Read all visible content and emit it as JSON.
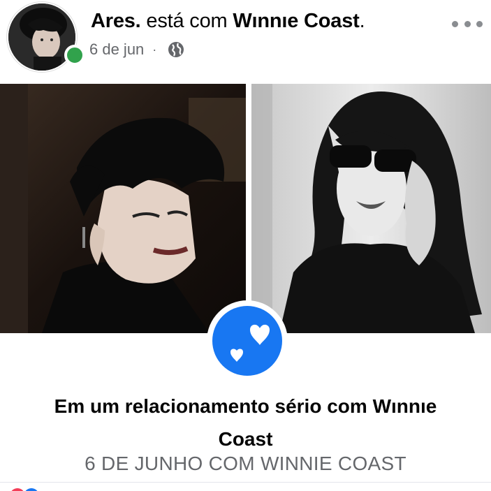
{
  "post": {
    "author": "Ares.",
    "connector": " está com ",
    "tagged": "Wınnıe Coast",
    "end": ".",
    "date": "6 de jun",
    "separator": "·",
    "privacy_icon": "globe-icon"
  },
  "event": {
    "icon": "hearts-icon",
    "title_line1": "Em um relacionamento sério com Wınnıe",
    "title_line2": "Coast",
    "subtitle": "6 DE JUNHO COM WINNIE COAST"
  },
  "colors": {
    "accent": "#1877f2",
    "online": "#31a24c",
    "secondary_text": "#65676b",
    "primary_text": "#050505"
  }
}
